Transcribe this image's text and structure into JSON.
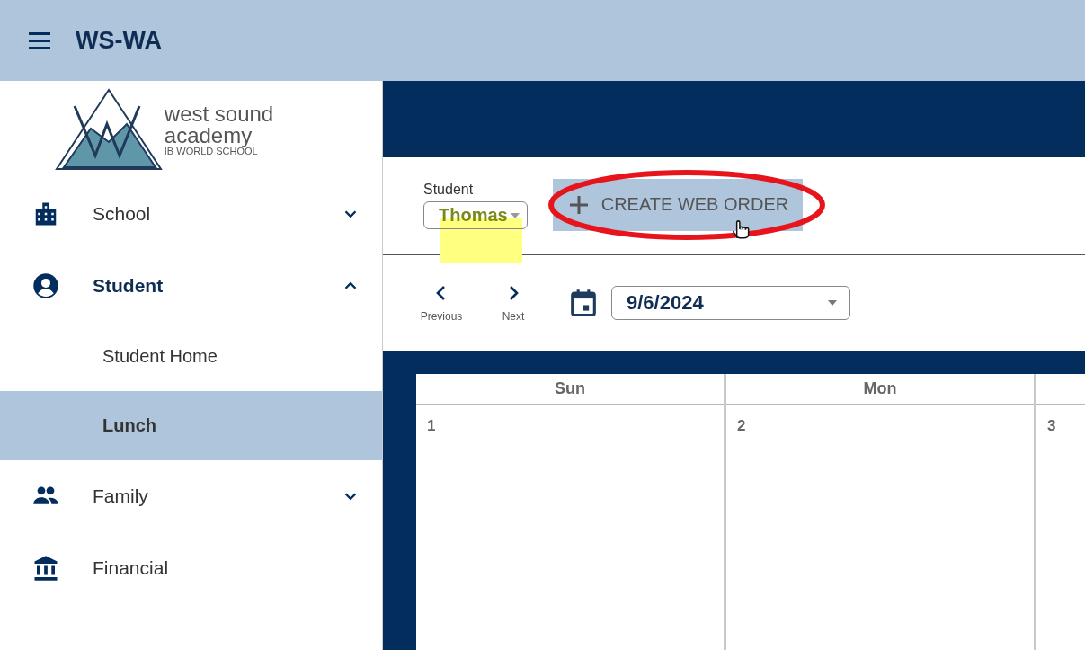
{
  "app_bar": {
    "title": "WS-WA"
  },
  "logo": {
    "lines": [
      "west sound",
      "academy",
      "IB WORLD SCHOOL"
    ]
  },
  "sidebar": {
    "items": [
      {
        "label": "School",
        "kind": "group",
        "expanded": false
      },
      {
        "label": "Student",
        "kind": "group",
        "expanded": true,
        "children": [
          {
            "label": "Student Home",
            "selected": false
          },
          {
            "label": "Lunch",
            "selected": true
          }
        ]
      },
      {
        "label": "Family",
        "kind": "group",
        "expanded": false
      },
      {
        "label": "Financial",
        "kind": "link"
      }
    ]
  },
  "student_select": {
    "label": "Student",
    "value": "Thomas",
    "marker": {
      "kind": "highlight"
    }
  },
  "create_button": {
    "label": "CREATE WEB ORDER",
    "marker": {
      "kind": "ellipse"
    }
  },
  "date_nav": {
    "previous": "Previous",
    "next": "Next",
    "date": "9/6/2024"
  },
  "calendar": {
    "columns": [
      {
        "header": "Sun",
        "day": "1"
      },
      {
        "header": "Mon",
        "day": "2"
      },
      {
        "day": "3"
      }
    ]
  }
}
